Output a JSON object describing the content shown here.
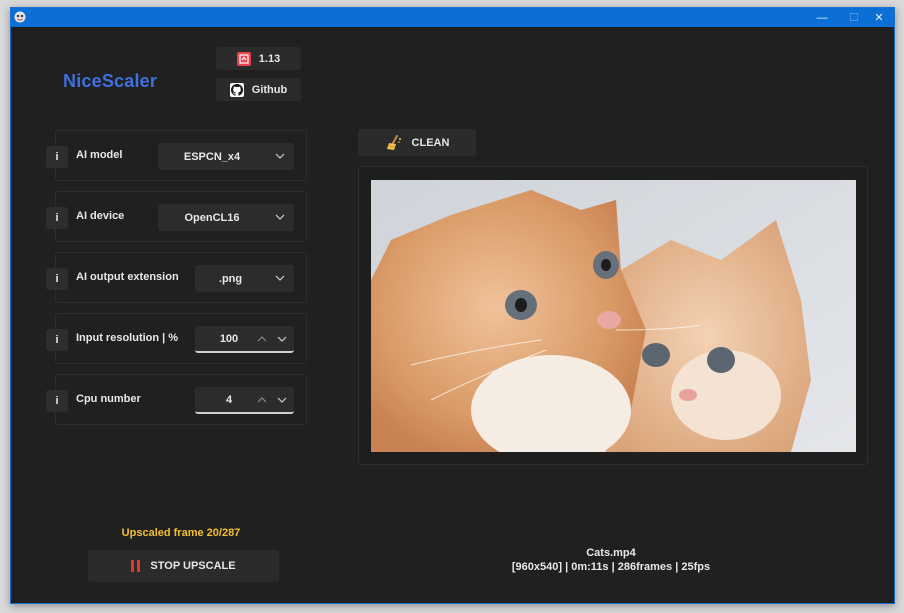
{
  "app": {
    "title": "NiceScaler",
    "version_label": "1.13",
    "github_label": "Github"
  },
  "window_controls": {
    "minimize": "—",
    "maximize": "☐",
    "close": "✕"
  },
  "settings": [
    {
      "info": "i",
      "label": "AI model",
      "type": "dropdown",
      "value": "ESPCN_x4"
    },
    {
      "info": "i",
      "label": "AI device",
      "type": "dropdown",
      "value": "OpenCL16"
    },
    {
      "info": "i",
      "label": "AI output extension",
      "type": "dropdown",
      "value": ".png"
    },
    {
      "info": "i",
      "label": "Input resolution | %",
      "type": "spinbox",
      "value": "100"
    },
    {
      "info": "i",
      "label": "Cpu number",
      "type": "spinbox",
      "value": "4"
    }
  ],
  "clean_label": "CLEAN",
  "status": {
    "text": "Upscaled frame 20/287",
    "color": "#f3c02c"
  },
  "stop_label": "STOP UPSCALE",
  "file": {
    "name": "Cats.mp4",
    "info": "[960x540] | 0m:11s | 286frames | 25fps"
  },
  "colors": {
    "accent": "#3f6fe0",
    "titlebar": "#0b6fd6",
    "background": "#202020",
    "stop_icon": "#e63636"
  },
  "icons": {
    "version": "version-badge-icon",
    "github": "github-icon",
    "clean": "broom-icon",
    "stop": "pause-icon",
    "chevron": "chevron-down-icon"
  }
}
